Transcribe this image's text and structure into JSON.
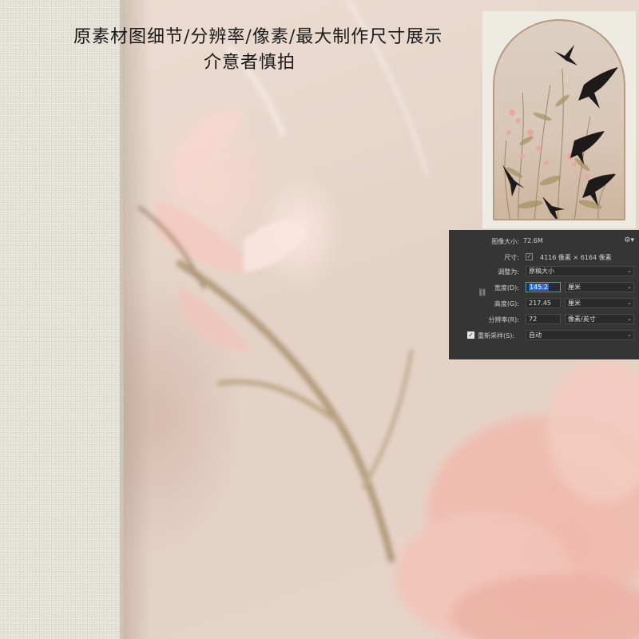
{
  "caption": {
    "line1": "原素材图细节/分辨率/像素/最大制作尺寸展示",
    "line2": "介意者慎拍"
  },
  "image_size_panel": {
    "image_size_label": "图像大小:",
    "image_size_value": "72.6M",
    "dimensions_label": "尺寸:",
    "dimensions_value": "4116 像素 × 6164 像素",
    "fit_to_label": "调整为:",
    "fit_to_value": "原稿大小",
    "width_label": "宽度(D):",
    "width_value": "145.2",
    "width_unit": "厘米",
    "height_label": "高度(G):",
    "height_value": "217.45",
    "height_unit": "厘米",
    "resolution_label": "分辨率(R):",
    "resolution_value": "72",
    "resolution_unit": "像素/英寸",
    "resample_label": "重新采样(S):",
    "resample_value": "自动",
    "resample_checked": true
  },
  "icons": {
    "gear": "gear-icon",
    "link": "link-chain-icon",
    "dropdown": "chevron-down-icon"
  },
  "colors": {
    "panel_bg": "#353535",
    "field_bg": "#2b2b2b",
    "selection": "#2f6bd1",
    "arch_border": "#b79c82",
    "swallow": "#1e1a1a"
  }
}
